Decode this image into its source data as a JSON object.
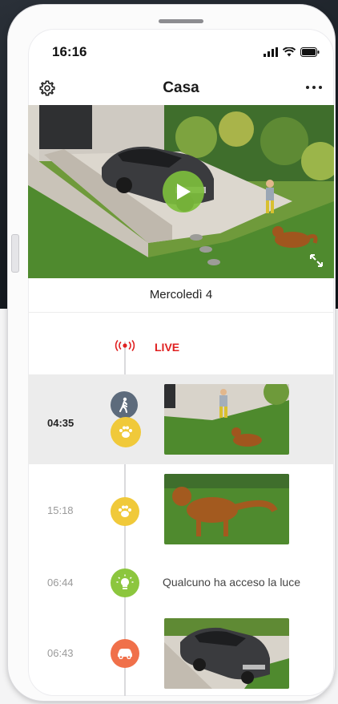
{
  "status_bar": {
    "time": "16:16"
  },
  "header": {
    "title": "Casa"
  },
  "date": {
    "label": "Mercoledì 4"
  },
  "live": {
    "label": "LIVE"
  },
  "events": [
    {
      "time": "04:35",
      "type": "person-and-pet",
      "icons": [
        "person-walking-icon",
        "paw-icon"
      ],
      "highlighted": true
    },
    {
      "time": "15:18",
      "type": "pet",
      "icons": [
        "paw-icon"
      ]
    },
    {
      "time": "06:44",
      "type": "light",
      "icons": [
        "light-bulb-icon"
      ],
      "caption": "Qualcuno ha acceso la luce"
    },
    {
      "time": "06:43",
      "type": "car",
      "icons": [
        "car-icon"
      ]
    }
  ],
  "colors": {
    "person": "#5d6b7c",
    "pet": "#f0c93a",
    "light": "#8cc63e",
    "car": "#f0704a",
    "live": "#e02020",
    "play": "#7dbe3c"
  }
}
